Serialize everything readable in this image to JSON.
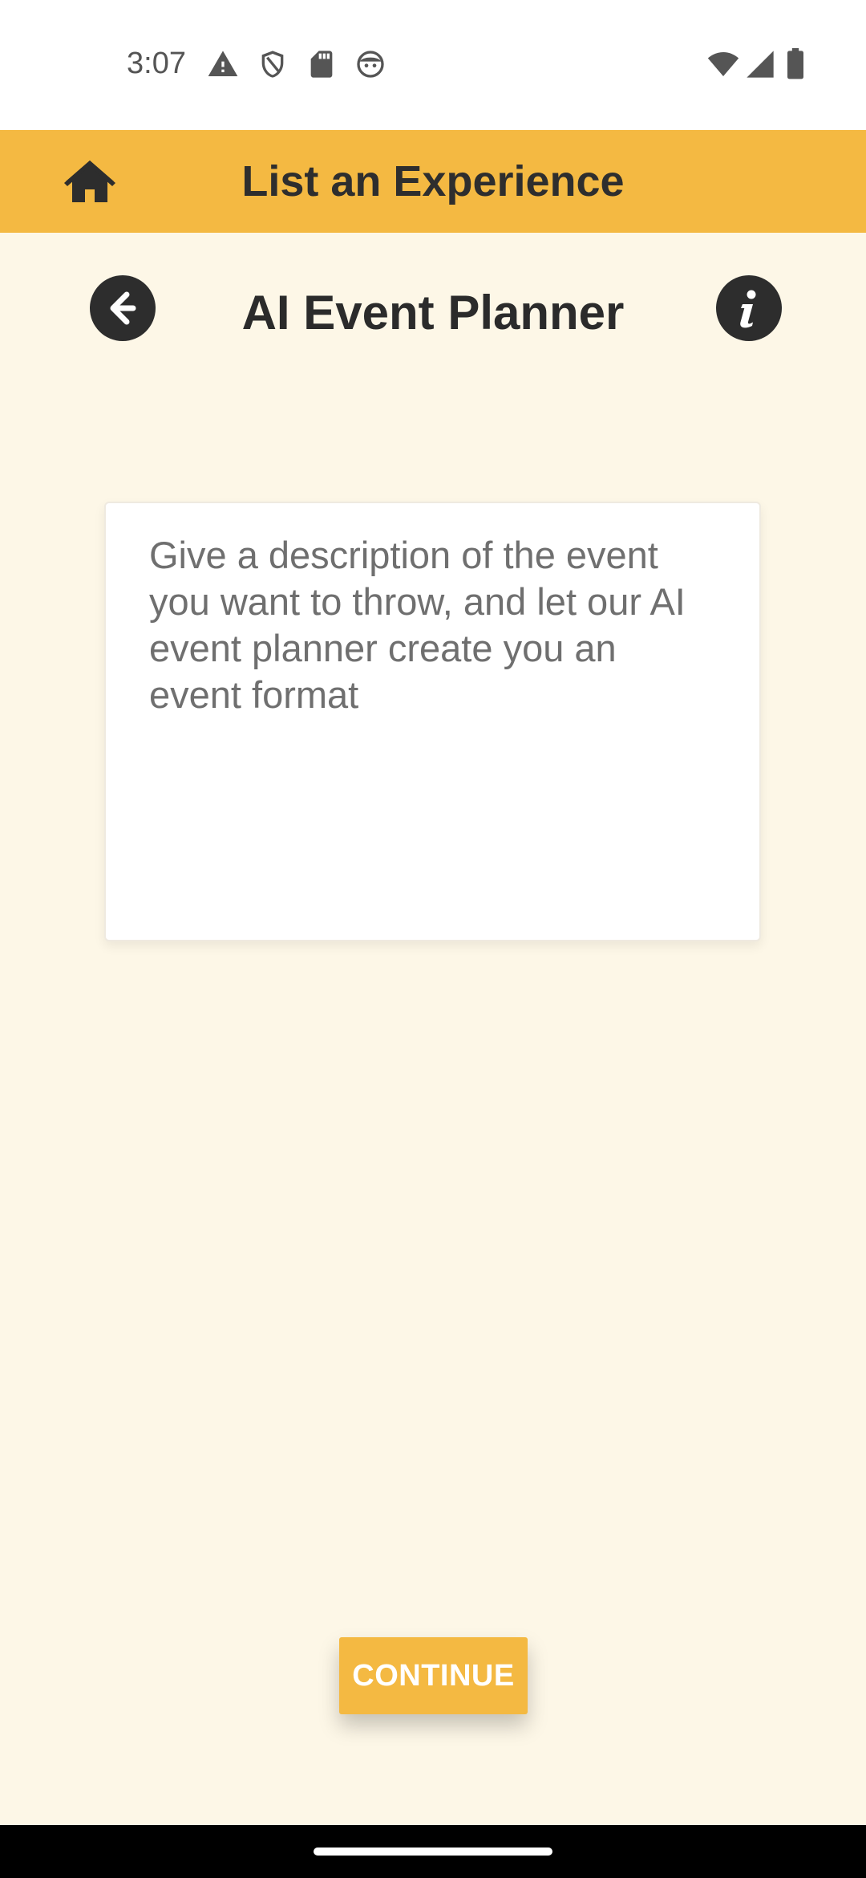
{
  "status_bar": {
    "time": "3:07",
    "left_icons": [
      "warning-icon",
      "shield-icon",
      "sd-card-icon",
      "face-icon"
    ],
    "right_icons": [
      "wifi-icon",
      "cell-signal-icon",
      "battery-icon"
    ]
  },
  "app_bar": {
    "title": "List an Experience",
    "home_icon": "home-icon",
    "background_color": "#F4B942"
  },
  "header": {
    "title": "AI Event Planner",
    "back_icon": "arrow-left-icon",
    "info_icon": "info-icon"
  },
  "description_input": {
    "value": "",
    "placeholder": "Give a description of the event you want to throw, and let our AI event planner create you an event format"
  },
  "footer": {
    "continue_label": "CONTINUE",
    "accent_color": "#F4B942"
  },
  "page_background": "#FDF7E7"
}
